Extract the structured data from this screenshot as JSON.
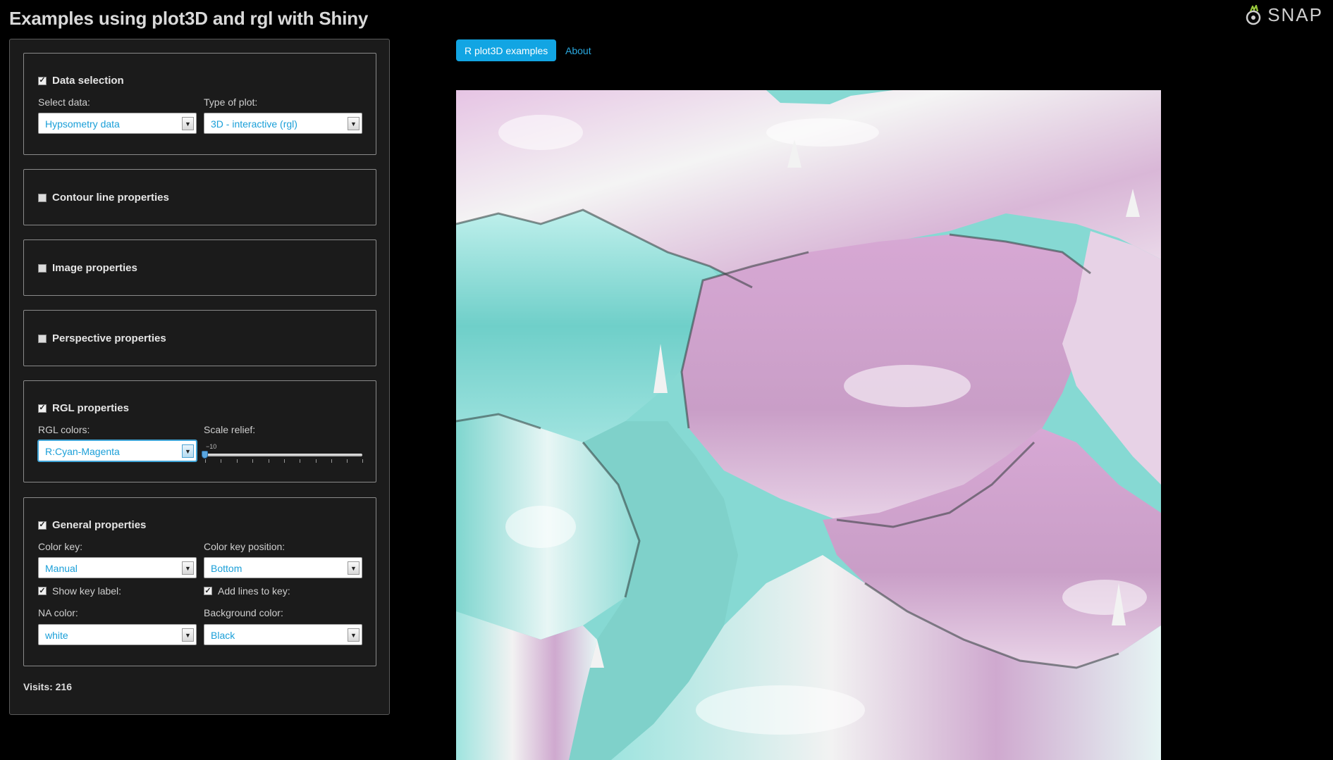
{
  "header": {
    "title": "Examples using plot3D and rgl with Shiny",
    "logo_text": "SNAP"
  },
  "tabs": [
    {
      "label": "R plot3D examples",
      "active": true
    },
    {
      "label": "About",
      "active": false
    }
  ],
  "sidebar": {
    "data_selection": {
      "heading": "Data selection",
      "checked": true,
      "select_data_label": "Select data:",
      "select_data_value": "Hypsometry data",
      "plot_type_label": "Type of plot:",
      "plot_type_value": "3D - interactive (rgl)"
    },
    "contour": {
      "heading": "Contour line properties",
      "checked": false
    },
    "image": {
      "heading": "Image properties",
      "checked": false
    },
    "perspective": {
      "heading": "Perspective properties",
      "checked": false
    },
    "rgl": {
      "heading": "RGL properties",
      "checked": true,
      "colors_label": "RGL colors:",
      "colors_value": "R:Cyan-Magenta",
      "scale_label": "Scale relief:",
      "scale_min": "−10",
      "scale_value": -10
    },
    "general": {
      "heading": "General properties",
      "checked": true,
      "color_key_label": "Color key:",
      "color_key_value": "Manual",
      "key_position_label": "Color key position:",
      "key_position_value": "Bottom",
      "show_key_label": "Show key label:",
      "show_key_checked": true,
      "add_lines_label": "Add lines to key:",
      "add_lines_checked": true,
      "na_color_label": "NA color:",
      "na_color_value": "white",
      "bg_color_label": "Background color:",
      "bg_color_value": "Black"
    },
    "visits": "Visits: 216"
  },
  "colors": {
    "accent": "#12a5e3",
    "select_text": "#1a9fd8",
    "relief_cyan": "#6fd6d0",
    "relief_magenta": "#d9a6d6",
    "relief_white": "#ffffff"
  }
}
